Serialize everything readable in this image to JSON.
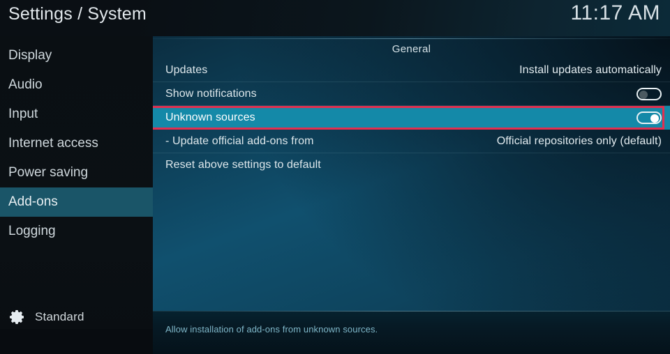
{
  "window": {
    "title": "Settings / System",
    "clock": "11:17 AM"
  },
  "sidebar": {
    "items": [
      {
        "label": "Display",
        "selected": false
      },
      {
        "label": "Audio",
        "selected": false
      },
      {
        "label": "Input",
        "selected": false
      },
      {
        "label": "Internet access",
        "selected": false
      },
      {
        "label": "Power saving",
        "selected": false
      },
      {
        "label": "Add-ons",
        "selected": true
      },
      {
        "label": "Logging",
        "selected": false
      }
    ],
    "profile": {
      "icon": "gear-icon",
      "label": "Standard"
    }
  },
  "content": {
    "section_title": "General",
    "rows": [
      {
        "label": "Updates",
        "value": "Install updates automatically"
      },
      {
        "label": "Show notifications",
        "toggle": "off"
      },
      {
        "label": "Unknown sources",
        "toggle": "on",
        "selected": true,
        "annotated": true
      },
      {
        "label": "- Update official add-ons from",
        "value": "Official repositories only (default)"
      },
      {
        "label": "Reset above settings to default"
      }
    ]
  },
  "help": {
    "text": "Allow installation of add-ons from unknown sources."
  },
  "colors": {
    "selected_row": "#1489a8",
    "sidebar_selected": "#1a5568",
    "annotation_border": "#e03050",
    "help_text": "#7fb7c9"
  }
}
